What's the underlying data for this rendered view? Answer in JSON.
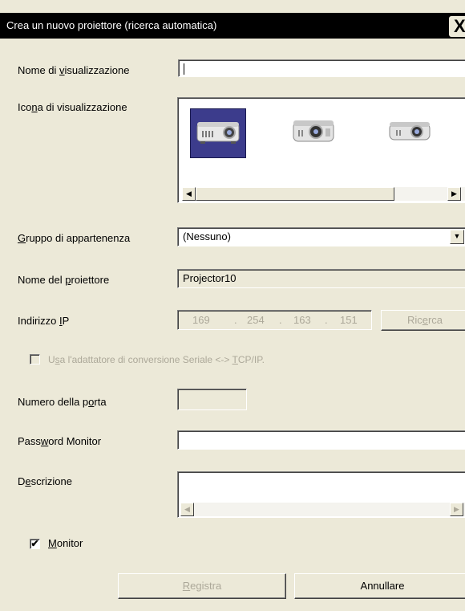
{
  "window": {
    "title": "Crea un nuovo proiettore (ricerca automatica)",
    "close_glyph": "X"
  },
  "labels": {
    "display_name": "Nome di visualizzazione",
    "display_icon": "Icona di visualizzazione",
    "group": "Gruppo di appartenenza",
    "projector_name": "Nome del proiettore",
    "ip_address": "Indirizzo IP",
    "serial_adapter": "Usa l'adattatore di conversione Seriale <-> TCP/IP.",
    "port_number": "Numero della porta",
    "monitor_password": "Password Monitor",
    "description": "Descrizione",
    "monitor": "Monitor"
  },
  "fields": {
    "display_name_value": "",
    "group_value": "(Nessuno)",
    "projector_name_value": "Projector10",
    "ip": [
      "169",
      "254",
      "163",
      "151"
    ],
    "port_value": "",
    "password_value": "",
    "description_value": ""
  },
  "icons": {
    "projectors": [
      "projector-icon-selected",
      "projector-icon-front",
      "projector-icon-side"
    ],
    "selected_index": 0
  },
  "checkboxes": {
    "serial_adapter_checked": false,
    "monitor_checked": true
  },
  "buttons": {
    "search": "Ricerca",
    "register": "Registra",
    "cancel": "Annullare"
  },
  "colors": {
    "window_bg": "#ece9d8",
    "titlebar_bg": "#000000",
    "selection": "#3c3c8c",
    "disabled_text": "#aca899"
  }
}
